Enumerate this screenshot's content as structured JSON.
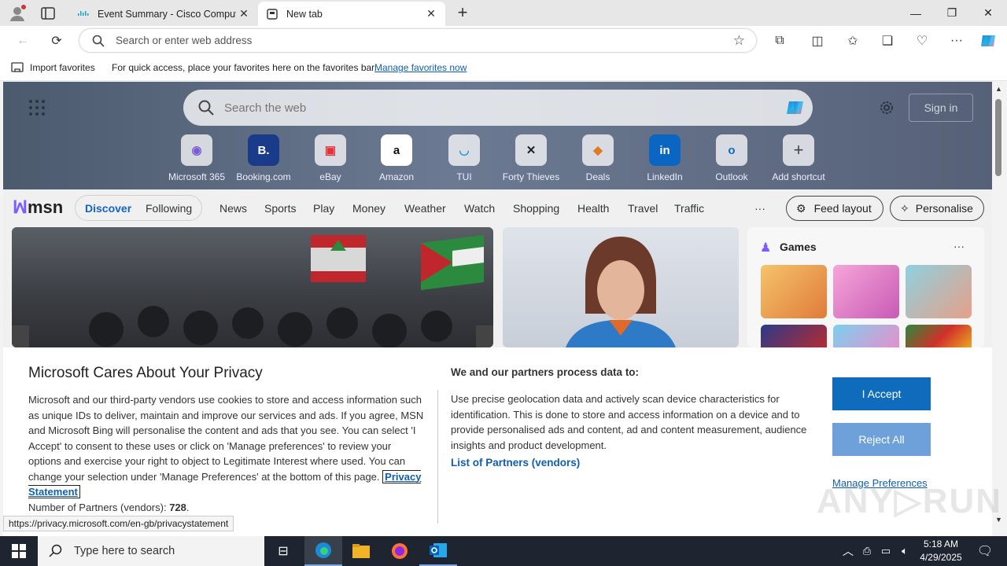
{
  "browser": {
    "tabs": [
      {
        "title": "Event Summary - Cisco Compute"
      },
      {
        "title": "New tab"
      }
    ],
    "address_placeholder": "Search or enter web address",
    "favorites_bar": {
      "import_label": "Import favorites",
      "hint": "For quick access, place your favorites here on the favorites bar.",
      "manage_link": "Manage favorites now"
    }
  },
  "newtab": {
    "search_placeholder": "Search the web",
    "signin_label": "Sign in",
    "shortcuts": [
      {
        "label": "Microsoft 365"
      },
      {
        "label": "Booking.com"
      },
      {
        "label": "eBay"
      },
      {
        "label": "Amazon"
      },
      {
        "label": "TUI"
      },
      {
        "label": "Forty Thieves"
      },
      {
        "label": "Deals"
      },
      {
        "label": "LinkedIn"
      },
      {
        "label": "Outlook"
      },
      {
        "label": "Add shortcut"
      }
    ],
    "msn": {
      "logo": "msn",
      "primary_tabs": [
        {
          "label": "Discover"
        },
        {
          "label": "Following"
        }
      ],
      "nav": [
        "News",
        "Sports",
        "Play",
        "Money",
        "Weather",
        "Watch",
        "Shopping",
        "Health",
        "Travel",
        "Traffic"
      ],
      "more": "···",
      "feed_layout_label": "Feed layout",
      "personalise_label": "Personalise"
    },
    "games_title": "Games",
    "games_more": "···"
  },
  "consent": {
    "title": "Microsoft Cares About Your Privacy",
    "body": "Microsoft and our third-party vendors use cookies to store and access information such as unique IDs to deliver, maintain and improve our services and ads. If you agree, MSN and Microsoft Bing will personalise the content and ads that you see. You can select 'I Accept' to consent to these uses or click on 'Manage preferences' to review your options and exercise your right to object to Legitimate Interest where used.  You can change your selection under 'Manage Preferences' at the bottom of this page.",
    "privacy_link": "Privacy Statement",
    "partners_count_label": "Number of Partners (vendors):",
    "partners_count": "728",
    "purposes_title": "We and our partners process data to:",
    "purposes_text": "Use precise geolocation data and actively scan device characteristics for identification. This is done to store and access information on a device and to provide personalised ads and content, ad and content measurement, audience insights and product development.",
    "partners_link": "List of Partners (vendors)",
    "accept_label": "I Accept",
    "reject_label": "Reject All",
    "manage_label": "Manage Preferences"
  },
  "status_url": "https://privacy.microsoft.com/en-gb/privacystatement",
  "taskbar": {
    "search_placeholder": "Type here to search",
    "time": "5:18 AM",
    "date": "4/29/2025"
  },
  "colors": {
    "accent": "#0f6cbd",
    "reject": "#6ea1d9",
    "link": "#0f5fae"
  }
}
